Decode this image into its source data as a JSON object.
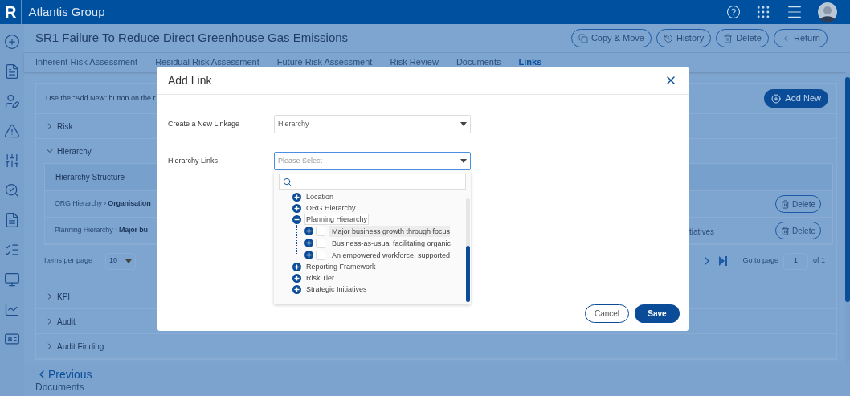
{
  "header": {
    "logo": "R",
    "org": "Atlantis Group"
  },
  "page": {
    "title": "SR1 Failure To Reduce Direct Greenhouse Gas Emissions",
    "actions": [
      "Copy & Move",
      "History",
      "Delete",
      "Return"
    ]
  },
  "tabs": [
    {
      "label": "Inherent Risk Assessment",
      "selected": false
    },
    {
      "label": "Residual Risk Assessment",
      "selected": false
    },
    {
      "label": "Future Risk Assessment",
      "selected": false
    },
    {
      "label": "Risk Review",
      "selected": false
    },
    {
      "label": "Documents",
      "selected": false
    },
    {
      "label": "Links",
      "selected": true
    }
  ],
  "links": {
    "instruction": "Use the “Add New” button on the r",
    "add_new": "Add New",
    "sections": [
      {
        "label": "Risk",
        "expanded": false
      },
      {
        "label": "Hierarchy",
        "expanded": true,
        "table": {
          "header": "Hierarchy Structure",
          "rows": [
            {
              "path": "ORG Hierarchy",
              "separator": "›",
              "leaf": "Organisation",
              "action": "Delete"
            },
            {
              "path": "Planning Hierarchy",
              "separator": "›",
              "leaf": "Major bu",
              "trailing": "tiatives",
              "action": "Delete"
            }
          ]
        },
        "pagination": {
          "items_label": "Items per page",
          "items_value": "10",
          "goto_label": "Go to page",
          "page": "1",
          "of": "of 1"
        }
      },
      {
        "label": "KPI",
        "expanded": false
      },
      {
        "label": "Audit",
        "expanded": false
      },
      {
        "label": "Audit Finding",
        "expanded": false
      }
    ]
  },
  "footer": {
    "previous": "Previous",
    "next_title": "Documents"
  },
  "modal": {
    "title": "Add Link",
    "fields": [
      {
        "label": "Create a New Linkage",
        "value": "Hierarchy",
        "focused": false
      },
      {
        "label": "Hierarchy Links",
        "placeholder": "Please Select",
        "focused": true
      }
    ],
    "tree": [
      {
        "label": "Location",
        "expanded": false,
        "focused": false
      },
      {
        "label": "ORG Hierarchy",
        "expanded": false,
        "focused": false
      },
      {
        "label": "Planning Hierarchy",
        "expanded": true,
        "focused": true,
        "children": [
          {
            "label": "Major business growth through focus",
            "checked": false,
            "hovered": true
          },
          {
            "label": "Business-as-usual facilitating organic",
            "checked": false,
            "hovered": false
          },
          {
            "label": "An empowered workforce, supported",
            "checked": false,
            "hovered": false
          }
        ]
      },
      {
        "label": "Reporting Framework",
        "expanded": false,
        "focused": false
      },
      {
        "label": "Risk Tier",
        "expanded": false,
        "focused": false
      },
      {
        "label": "Strategic Initiatives",
        "expanded": false,
        "focused": false
      }
    ],
    "buttons": [
      {
        "label": "Cancel",
        "kind": "secondary"
      },
      {
        "label": "Save",
        "kind": "primary"
      }
    ]
  }
}
